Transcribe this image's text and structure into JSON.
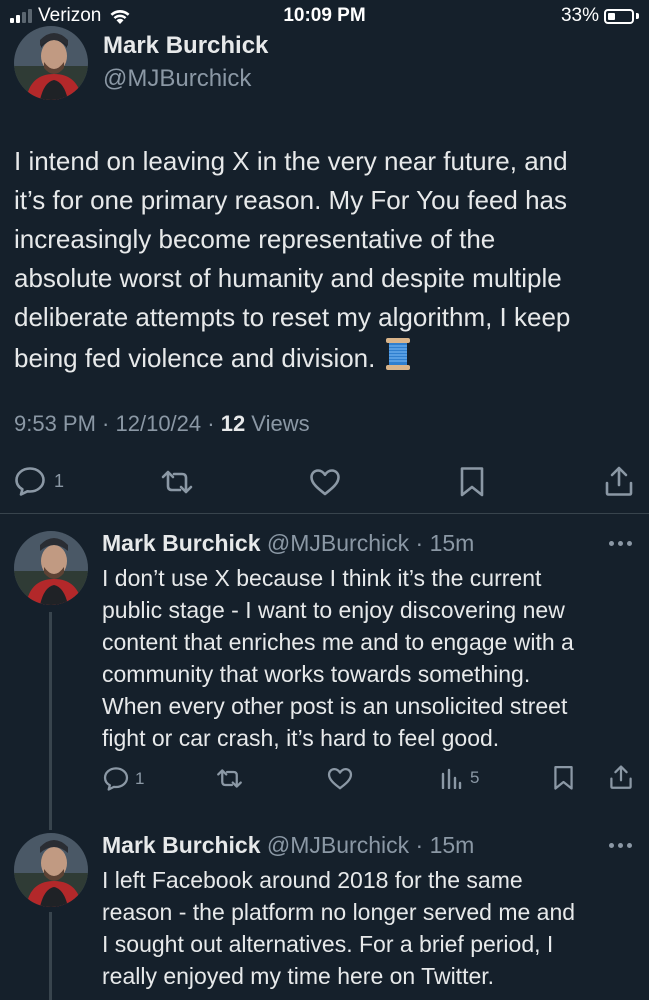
{
  "status_bar": {
    "carrier": "Verizon",
    "time": "10:09 PM",
    "battery_percent": "33%",
    "battery_level": 0.33,
    "signal_bars": 2
  },
  "main_post": {
    "author_name": "Mark Burchick",
    "author_handle": "@MJBurchick",
    "text_lines": [
      "I intend on leaving X in the very near future, and",
      "it’s for one primary reason. My For You feed has",
      "increasingly become representative of the",
      "absolute worst of humanity and despite multiple",
      "deliberate attempts to reset my algorithm, I keep",
      "being fed violence and division."
    ],
    "emoji": "spool-of-thread",
    "meta": {
      "time": "9:53 PM",
      "separator": " · ",
      "date": "12/10/24",
      "views_count": "12",
      "views_label": " Views"
    },
    "actions": {
      "reply_count": "1",
      "icons": [
        "reply-icon",
        "repost-icon",
        "like-icon",
        "bookmark-icon",
        "share-icon"
      ]
    }
  },
  "replies": [
    {
      "author_name": "Mark Burchick",
      "author_handle": "@MJBurchick",
      "separator": " · ",
      "age": "15m",
      "text_lines": [
        "I don’t use X because I think it’s the current",
        "public stage - I want to enjoy discovering new",
        "content that enriches me and to engage with a",
        "community that works towards something.",
        "When every other post is an unsolicited street",
        "fight or car crash, it’s hard to feel good."
      ],
      "reply_count": "1",
      "views_count": "5"
    },
    {
      "author_name": "Mark Burchick",
      "author_handle": "@MJBurchick",
      "separator": " · ",
      "age": "15m",
      "text_lines": [
        "I left Facebook around 2018 for the same",
        "reason - the platform no longer served me and",
        "I sought out alternatives. For a brief period, I",
        "really enjoyed my time here on Twitter."
      ]
    }
  ],
  "colors": {
    "background": "#15202b",
    "text": "#e7e9ea",
    "secondary": "#8b98a5",
    "divider": "#38444d"
  }
}
